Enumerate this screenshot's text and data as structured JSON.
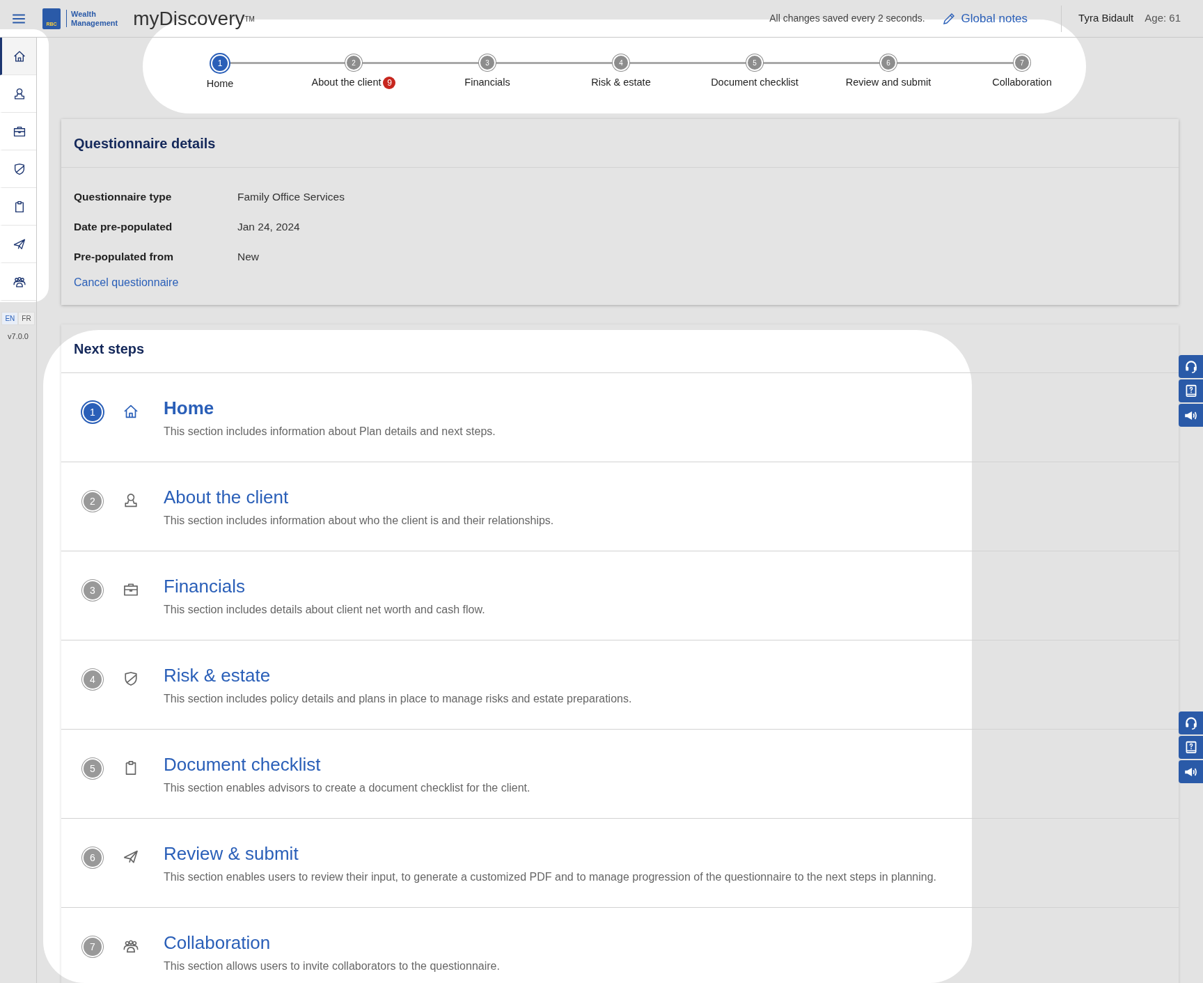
{
  "header": {
    "logo_mark": "RBC",
    "logo_lines": [
      "Wealth",
      "Management"
    ],
    "app_title": "myDiscovery$^{TM}$",
    "save_status": "All changes saved every 2 seconds.",
    "global_notes": "Global notes",
    "client_name": "Tyra Bidault",
    "client_age": "Age: 61"
  },
  "sidebar": {
    "items": [
      {
        "selected": true
      },
      {
        "selected": false
      },
      {
        "selected": false
      },
      {
        "selected": false
      },
      {
        "selected": false
      },
      {
        "selected": false
      },
      {
        "selected": false
      }
    ],
    "languages": [
      {
        "label": "EN",
        "selected": true
      },
      {
        "label": "FR",
        "selected": false
      }
    ],
    "version": "v7.0.0"
  },
  "stepper": {
    "steps": [
      {
        "number": "1",
        "label": "Home",
        "selected": true
      },
      {
        "number": "2",
        "label": "About the client",
        "badge": "9",
        "selected": false
      },
      {
        "number": "3",
        "label": "Financials",
        "selected": false
      },
      {
        "number": "4",
        "label": "Risk & estate",
        "selected": false
      },
      {
        "number": "5",
        "label": "Document checklist",
        "selected": false
      },
      {
        "number": "6",
        "label": "Review and submit",
        "selected": false
      },
      {
        "number": "7",
        "label": "Collaboration",
        "selected": false
      }
    ]
  },
  "questionnaire_details": {
    "title": "Questionnaire details",
    "fields": [
      {
        "label": "Questionnaire type",
        "value": "Family Office Services"
      },
      {
        "label": "Date pre-populated",
        "value": "Jan 24, 2024"
      },
      {
        "label": "Pre-populated from",
        "value": "New"
      }
    ],
    "cancel_link": "Cancel questionnaire"
  },
  "next_steps": {
    "title": "Next steps",
    "items": [
      {
        "number": "1",
        "title": "Home",
        "description": "This section includes information about Plan details and next steps.",
        "selected": true
      },
      {
        "number": "2",
        "title": "About the client",
        "description": "This section includes information about who the client is and their relationships.",
        "selected": false
      },
      {
        "number": "3",
        "title": "Financials",
        "description": "This section includes details about client net worth and cash flow.",
        "selected": false
      },
      {
        "number": "4",
        "title": "Risk & estate",
        "description": "This section includes policy details and plans in place to manage risks and estate preparations.",
        "selected": false
      },
      {
        "number": "5",
        "title": "Document checklist",
        "description": "This section enables advisors to create a document checklist for the client.",
        "selected": false
      },
      {
        "number": "6",
        "title": "Review & submit",
        "description": "This section enables users to review their input, to generate a customized PDF and to manage progression of the questionnaire to the next steps in planning.",
        "selected": false
      },
      {
        "number": "7",
        "title": "Collaboration",
        "description": "This section allows users to invite collaborators to the questionnaire.",
        "selected": false
      }
    ]
  }
}
